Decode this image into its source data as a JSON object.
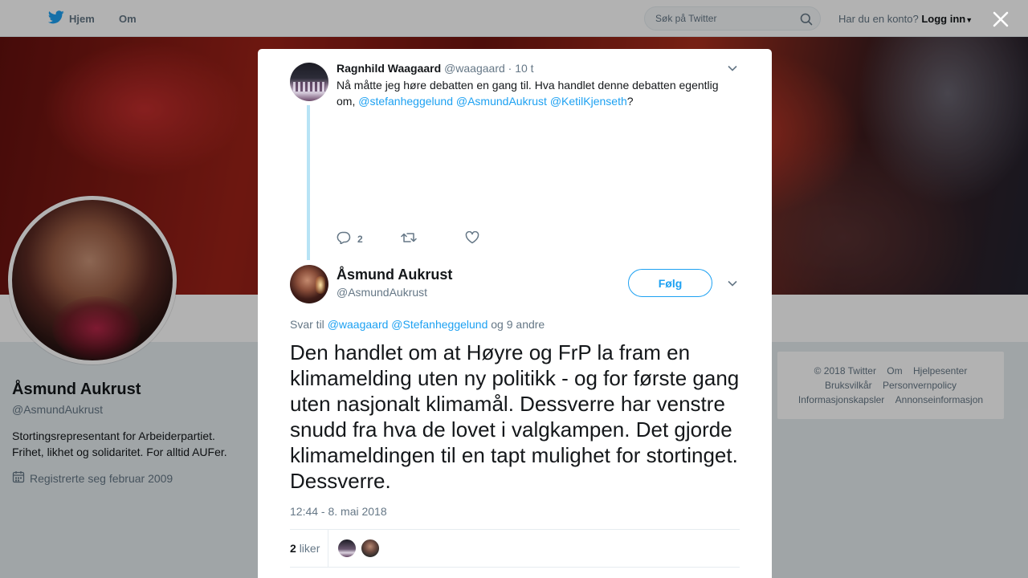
{
  "topnav": {
    "home_label": "Hjem",
    "about_label": "Om",
    "search_placeholder": "Søk på Twitter",
    "login_prompt": "Har du en konto?",
    "login_label": "Logg inn"
  },
  "profile": {
    "name": "Åsmund Aukrust",
    "handle": "@AsmundAukrust",
    "bio": "Stortingsrepresentant for Arbeiderpartiet. Frihet, likhet og solidaritet. For alltid AUFer.",
    "joined": "Registrerte seg februar 2009"
  },
  "footer": {
    "links": [
      "© 2018 Twitter",
      "Om",
      "Hjelpesenter",
      "Bruksvilkår",
      "Personvernpolicy",
      "Informasjonskapsler",
      "Annonseinformasjon"
    ]
  },
  "parent_tweet": {
    "name": "Ragnhild Waagaard",
    "handle": "@waagaard",
    "time": "· 10 t",
    "text_before": "Nå måtte jeg høre debatten en gang til. Hva handlet denne debatten egentlig om,",
    "mentions": [
      "@stefanheggelund",
      "@AsmundAukrust",
      "@KetilKjenseth"
    ],
    "text_after": "?",
    "reply_count": "2"
  },
  "main_tweet": {
    "name": "Åsmund Aukrust",
    "handle": "@AsmundAukrust",
    "follow_label": "Følg",
    "reply_prefix": "Svar til",
    "reply_mentions": [
      "@waagaard",
      "@Stefanheggelund"
    ],
    "reply_suffix": "og 9 andre",
    "text": "Den handlet om at Høyre og FrP la fram en klimamelding uten ny politikk - og for første gang uten nasjonalt klimamål. Dessverre har venstre snudd fra hva de lovet i valgkampen. Det gjorde klimameldingen til en tapt mulighet for stortinget. Dessverre.",
    "timestamp": "12:44 - 8. mai 2018",
    "likes_count": "2",
    "likes_label": "liker"
  },
  "colors": {
    "accent": "#1da1f2",
    "muted": "#657786",
    "text": "#14171a",
    "thread_line": "#b7e3f5"
  }
}
